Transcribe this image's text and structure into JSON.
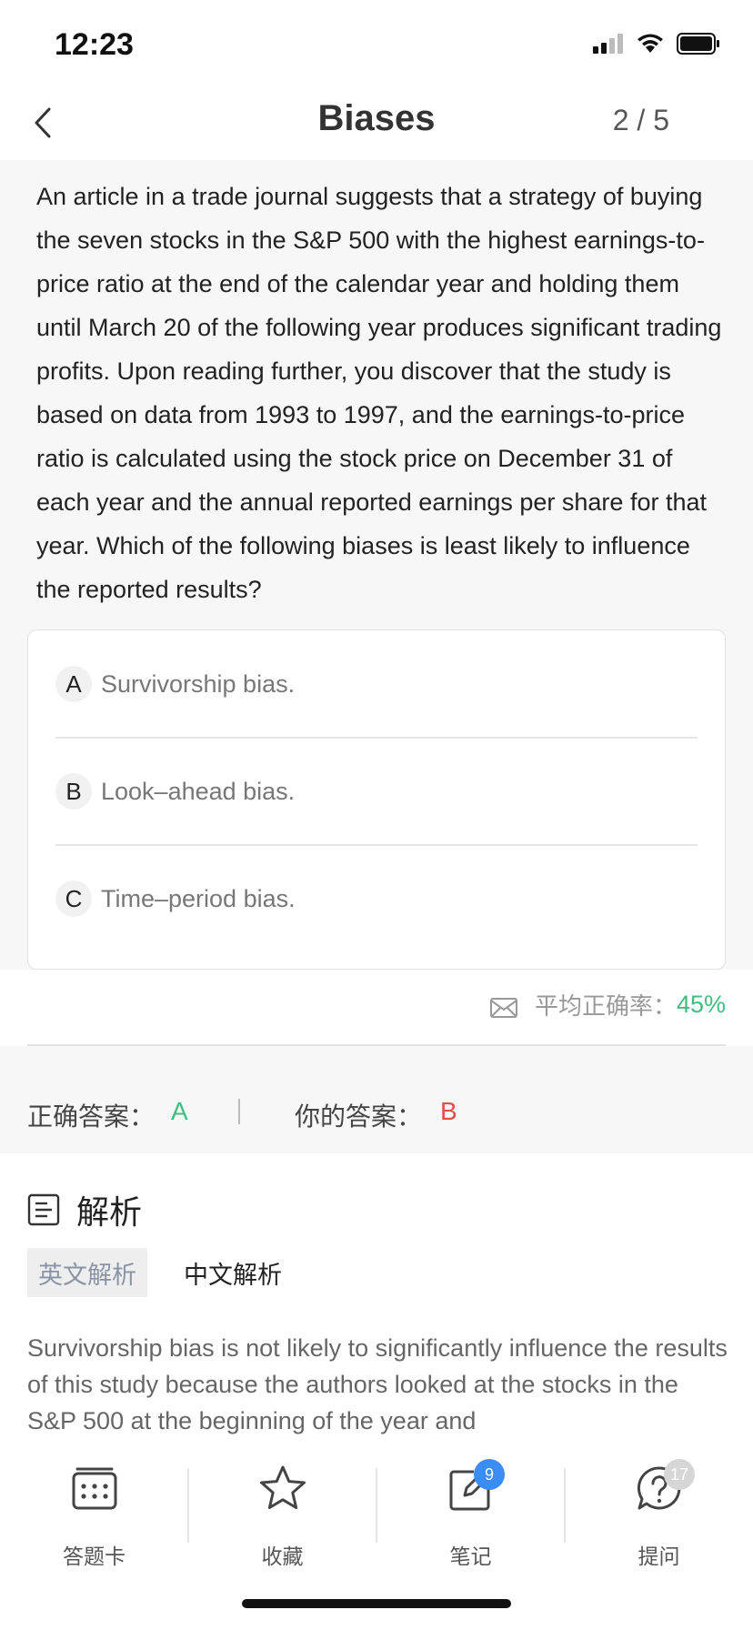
{
  "status_bar": {
    "time": "12:23"
  },
  "nav": {
    "title": "Biases",
    "progress": "2 / 5"
  },
  "question": {
    "text": "An article in a trade journal suggests that a strategy of buying the seven stocks in the S&P 500 with the highest earnings-to-price ratio at the end of the calendar year and holding them until March 20 of the following year produces significant trading profits. Upon reading further, you discover that the study is based on data from 1993 to 1997, and the earnings-to-price ratio is calculated using the stock price on December 31 of each year and the annual reported earnings per share for that year. Which of the following biases is least likely to influence the reported results?",
    "options": [
      {
        "letter": "A",
        "text": "Survivorship bias."
      },
      {
        "letter": "B",
        "text": "Look–ahead bias."
      },
      {
        "letter": "C",
        "text": "Time–period bias."
      }
    ]
  },
  "stats": {
    "label": "平均正确率：",
    "value": "45%",
    "value_color": "#3fbf7f",
    "icon": "mail-icon"
  },
  "answers": {
    "correct_label": "正确答案：",
    "correct_value": "A",
    "correct_color": "#3fbf7f",
    "user_label": "你的答案：",
    "user_value": "B",
    "user_color": "#e0504a"
  },
  "analysis": {
    "title": "解析",
    "tabs": [
      {
        "label": "英文解析",
        "active": true
      },
      {
        "label": "中文解析",
        "active": false
      }
    ],
    "text": "Survivorship bias is not likely to significantly influence the results of this study because the authors looked at the stocks in the S&P 500 at the beginning of the year and"
  },
  "bottom_bar": {
    "items": [
      {
        "label": "答题卡",
        "icon": "answer-card-icon"
      },
      {
        "label": "收藏",
        "icon": "star-icon"
      },
      {
        "label": "笔记",
        "icon": "note-edit-icon",
        "badge": "9",
        "badge_color": "#3b8cf5"
      },
      {
        "label": "提问",
        "icon": "question-icon",
        "badge": "17",
        "badge_color": "#d6d6d6"
      }
    ]
  }
}
